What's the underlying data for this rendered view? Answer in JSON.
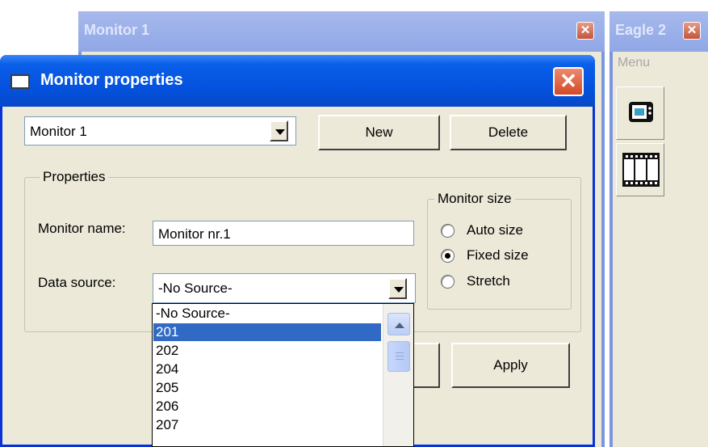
{
  "monitor_window": {
    "title": "Monitor 1"
  },
  "eagle_window": {
    "title": "Eagle 2",
    "menu_label": "Menu"
  },
  "dialog": {
    "title": "Monitor properties",
    "monitor_select": {
      "value": "Monitor 1"
    },
    "buttons": {
      "new": "New",
      "delete": "Delete",
      "apply": "Apply"
    },
    "properties_group": {
      "label": "Properties",
      "monitor_name_label": "Monitor name:",
      "monitor_name_value": "Monitor nr.1",
      "data_source_label": "Data source:",
      "data_source_value": "-No Source-"
    },
    "monitor_size_group": {
      "label": "Monitor size",
      "options": [
        "Auto size",
        "Fixed size",
        "Stretch"
      ],
      "selected": "Fixed size"
    },
    "data_source_list": {
      "options": [
        "-No Source-",
        "201",
        "202",
        "204",
        "205",
        "206",
        "207"
      ],
      "highlighted": "201"
    }
  },
  "icons": [
    "close-icon",
    "dropdown-arrow-icon",
    "monitor-icon",
    "film-icon",
    "scroll-up-icon"
  ]
}
